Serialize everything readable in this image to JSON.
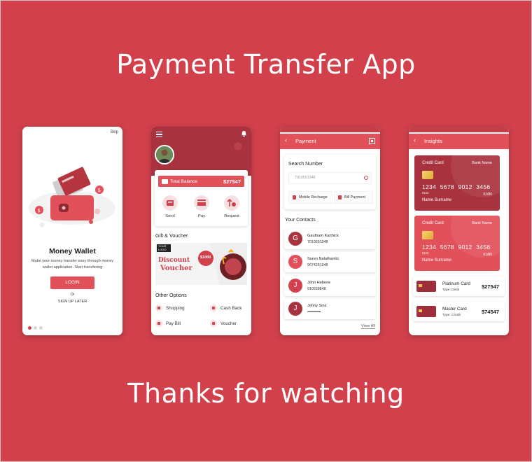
{
  "title": "Payment Transfer App",
  "footer": "Thanks for watching",
  "colors": {
    "background": "#d1404b",
    "accent": "#e2505a",
    "dark_accent": "#a8333f"
  },
  "onboarding": {
    "skip": "Skip",
    "heading": "Money Wallet",
    "description": "Make your money transfer easy through money wallet application. Start transfering",
    "login": "LOGIN",
    "or": "Or",
    "signup": "SIGN UP LATER",
    "page_index": 1,
    "page_count": 3
  },
  "home": {
    "balance_label": "Total Balance",
    "balance_value": "$27547",
    "actions": [
      {
        "label": "Send",
        "icon": "send-money-icon"
      },
      {
        "label": "Pay",
        "icon": "pay-card-icon"
      },
      {
        "label": "Request",
        "icon": "request-money-icon"
      }
    ],
    "gift_title": "Gift & Voucher",
    "voucher": {
      "logo": "YOUR LOGO",
      "line1": "Discount",
      "line2": "Voucher",
      "badge_amount": "$1000"
    },
    "options_title": "Other Options",
    "options": [
      {
        "label": "Shopping",
        "icon": "shopping-bag-icon"
      },
      {
        "label": "Cash Back",
        "icon": "cash-back-icon"
      },
      {
        "label": "Pay Bill",
        "icon": "pay-bill-icon"
      },
      {
        "label": "Voucher",
        "icon": "gift-icon"
      }
    ]
  },
  "payment": {
    "title": "Payment",
    "search_title": "Search Number",
    "search_value": "7010551048",
    "recharge": "Mobile Recharge",
    "bill": "Bill Payment",
    "contacts_title": "Your Contacts",
    "contacts": [
      {
        "initial": "G",
        "name": "Gautham Karthick",
        "phone": "7010551048",
        "color": "#a8333f"
      },
      {
        "initial": "S",
        "name": "Suren Nalathambi",
        "phone": "9674251048",
        "color": "#e2505a"
      },
      {
        "initial": "J",
        "name": "John Hebrew",
        "phone": "910558848",
        "color": "#d1404b"
      },
      {
        "initial": "J",
        "name": "Johny Sins",
        "phone": "••••••••••••••",
        "color": "#a8333f"
      }
    ],
    "view_all": "View All"
  },
  "insights": {
    "title": "Insights",
    "cards": [
      {
        "type": "Credit Card",
        "bank": "Bank Name",
        "number": "1234 5678 9012 3456",
        "small": "0123",
        "expiry": "01/80",
        "holder": "Name Surname",
        "color": "#a8333f"
      },
      {
        "type": "Credit Card",
        "bank": "Bank Name",
        "number": "1234 5678 9012 3456",
        "small": "0123",
        "expiry": "01/80",
        "holder": "Name Surname",
        "color": "#e2505a"
      }
    ],
    "plans": [
      {
        "name": "Platinum Card",
        "type": "Type: Debit",
        "amount": "$27547"
      },
      {
        "name": "Master Card",
        "type": "Type: Credit",
        "amount": "$74547"
      }
    ]
  }
}
